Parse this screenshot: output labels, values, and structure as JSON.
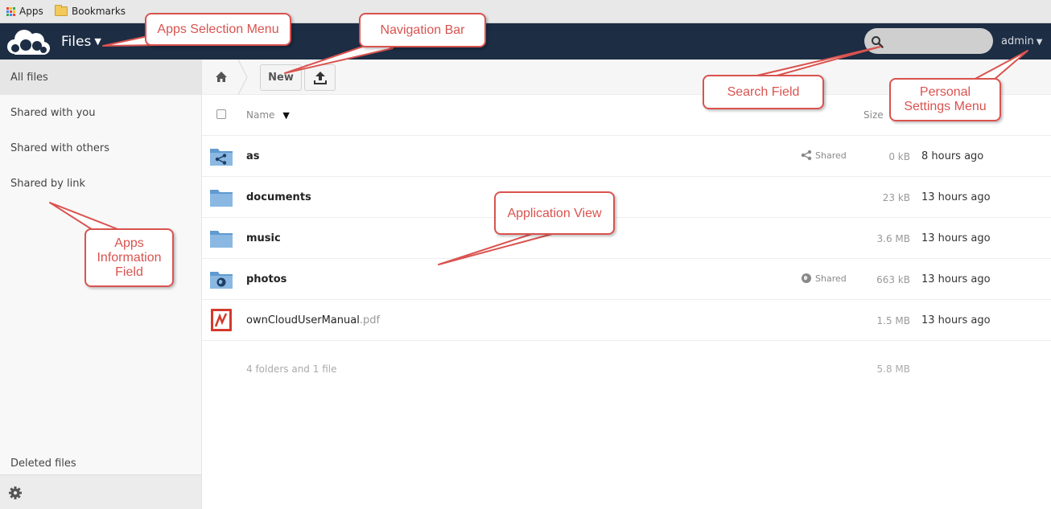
{
  "bookmarks_bar": {
    "apps_label": "Apps",
    "bookmarks_label": "Bookmarks",
    "apps_icon": "apps-grid-icon",
    "bookmarks_icon": "folder-icon"
  },
  "header": {
    "app_name": "Files",
    "logo_icon": "owncloud-cloud-logo",
    "search": {
      "placeholder": "",
      "value": "",
      "icon": "search-icon"
    },
    "user_label": "admin",
    "background_color": "#1d2d44"
  },
  "sidebar": {
    "items": [
      {
        "label": "All files",
        "active": true
      },
      {
        "label": "Shared with you"
      },
      {
        "label": "Shared with others"
      },
      {
        "label": "Shared by link"
      }
    ],
    "deleted_files": "Deleted files",
    "settings_icon": "gear-icon"
  },
  "controls": {
    "home_icon": "home-icon",
    "new_label": "New",
    "upload_icon": "upload-icon"
  },
  "table": {
    "columns": {
      "name": "Name",
      "size": "Size"
    },
    "rows": [
      {
        "name": "as",
        "ext": "",
        "type": "shared-folder",
        "shared_label": "Shared",
        "shared_icon": "share-icon",
        "size": "0 kB",
        "modified": "8 hours ago"
      },
      {
        "name": "documents",
        "ext": "",
        "type": "folder",
        "shared_label": "",
        "size": "23 kB",
        "modified": "13 hours ago"
      },
      {
        "name": "music",
        "ext": "",
        "type": "folder",
        "shared_label": "",
        "size": "3.6 MB",
        "modified": "13 hours ago"
      },
      {
        "name": "photos",
        "ext": "",
        "type": "public-folder",
        "shared_label": "Shared",
        "shared_icon": "globe-icon",
        "size": "663 kB",
        "modified": "13 hours ago"
      },
      {
        "name": "ownCloudUserManual",
        "ext": ".pdf",
        "type": "pdf",
        "shared_label": "",
        "size": "1.5 MB",
        "modified": "13 hours ago"
      }
    ],
    "summary": {
      "text": "4 folders and 1 file",
      "size": "5.8 MB"
    }
  },
  "annotations": {
    "apps_selection_menu": "Apps Selection Menu",
    "navigation_bar": "Navigation Bar",
    "search_field": "Search Field",
    "personal_settings_menu": "Personal Settings Menu",
    "application_view": "Application View",
    "apps_information_field": "Apps Information Field",
    "color": "#d9534f"
  }
}
